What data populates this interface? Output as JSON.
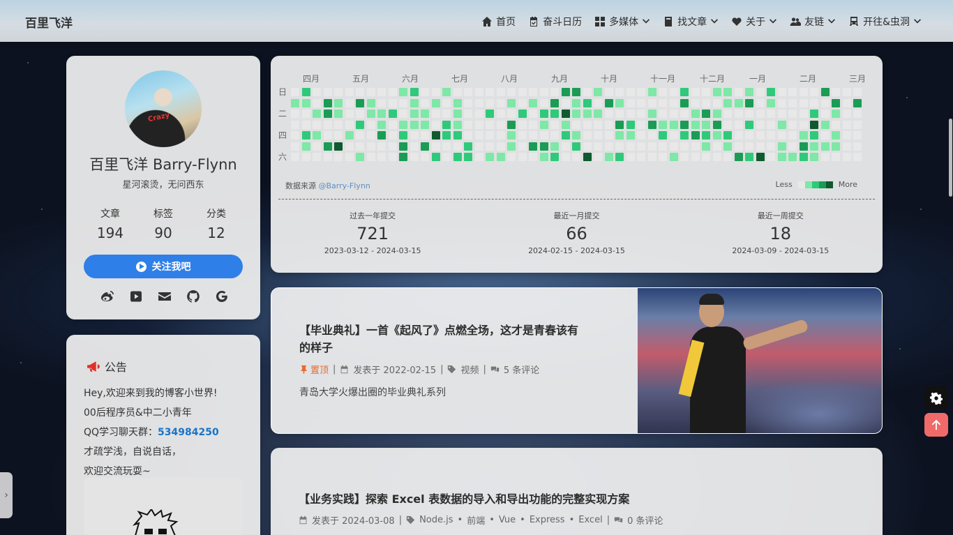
{
  "nav": {
    "brand": "百里飞洋",
    "items": [
      {
        "label": "首页",
        "icon": "home-icon",
        "has_dropdown": false
      },
      {
        "label": "奋斗日历",
        "icon": "calendar-icon",
        "has_dropdown": false
      },
      {
        "label": "多媒体",
        "icon": "media-icon",
        "has_dropdown": true
      },
      {
        "label": "找文章",
        "icon": "book-icon",
        "has_dropdown": true
      },
      {
        "label": "关于",
        "icon": "heart-icon",
        "has_dropdown": true
      },
      {
        "label": "友链",
        "icon": "users-icon",
        "has_dropdown": true
      },
      {
        "label": "开往&虫洞",
        "icon": "train-icon",
        "has_dropdown": true
      }
    ]
  },
  "profile": {
    "avatar_text": "Crazy",
    "name": "百里飞洋 Barry-Flynn",
    "motto": "星河滚烫，无问西东",
    "stats": [
      {
        "label": "文章",
        "value": "194"
      },
      {
        "label": "标签",
        "value": "90"
      },
      {
        "label": "分类",
        "value": "12"
      }
    ],
    "follow_label": "关注我吧",
    "socials": [
      "weibo-icon",
      "youtube-icon",
      "email-icon",
      "github-icon",
      "google-icon"
    ]
  },
  "notice": {
    "title": "公告",
    "line1": "Hey,欢迎来到我的博客小世界!",
    "line2": "00后程序员&中二小青年",
    "qq_label": "QQ学习聊天群：",
    "qq_number": "534984250",
    "line4": "才疏学浅，自说自话，",
    "line5": "欢迎交流玩耍~"
  },
  "heatmap": {
    "months": [
      "四月",
      "五月",
      "六月",
      "七月",
      "八月",
      "九月",
      "十月",
      "十一月",
      "十二月",
      "一月",
      "二月",
      "三月"
    ],
    "weekdays": [
      "日",
      "二",
      "四",
      "六"
    ],
    "source_label": "数据来源",
    "source_handle": "@Barry-Flynn",
    "legend_less": "Less",
    "legend_more": "More",
    "colors": [
      "#e8e8e8",
      "#7ee8a6",
      "#2fc97a",
      "#1a9c55",
      "#0f5a2e"
    ],
    "summaries": [
      {
        "label": "过去一年提交",
        "value": "721",
        "range": "2023-03-12 - 2024-03-15"
      },
      {
        "label": "最近一月提交",
        "value": "66",
        "range": "2024-02-15 - 2024-03-15"
      },
      {
        "label": "最近一周提交",
        "value": "18",
        "range": "2024-03-09 - 2024-03-15"
      }
    ]
  },
  "post1": {
    "title_line1": "【毕业典礼】一首《起风了》点燃全场，这才是青春该有",
    "title_line2": "的样子",
    "pinned": "置顶",
    "date": "发表于 2022-02-15",
    "category": "视频",
    "comments": "5 条评论",
    "desc": "青岛大学火爆出圈的毕业典礼系列"
  },
  "post2": {
    "title": "【业务实践】探索 Excel 表数据的导入和导出功能的完整实现方案",
    "date": "发表于 2024-03-08",
    "tags": [
      "Node.js",
      "前端",
      "Vue",
      "Express",
      "Excel"
    ],
    "comments": "0 条评论"
  },
  "side_tab_label": "›"
}
